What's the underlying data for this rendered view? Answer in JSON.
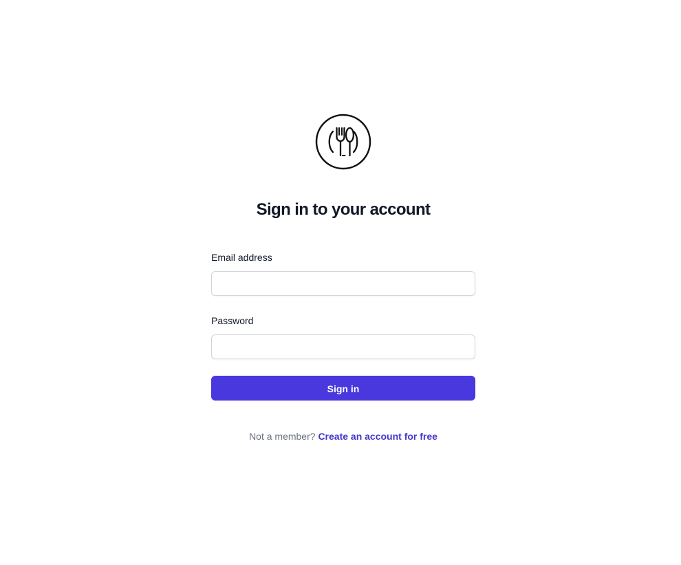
{
  "logo": {
    "icon": "plate-fork-spoon-icon",
    "color": "#111111"
  },
  "heading": "Sign in to your account",
  "form": {
    "email": {
      "label": "Email address",
      "value": "",
      "placeholder": ""
    },
    "password": {
      "label": "Password",
      "value": "",
      "placeholder": ""
    },
    "submit_label": "Sign in"
  },
  "signup": {
    "prompt": "Not a member?",
    "link_text": "Create an account for free"
  },
  "colors": {
    "accent": "#4838DE",
    "link": "#4338CA",
    "heading": "#111827",
    "muted": "#6B7280",
    "input_border": "#D1D5DB"
  }
}
